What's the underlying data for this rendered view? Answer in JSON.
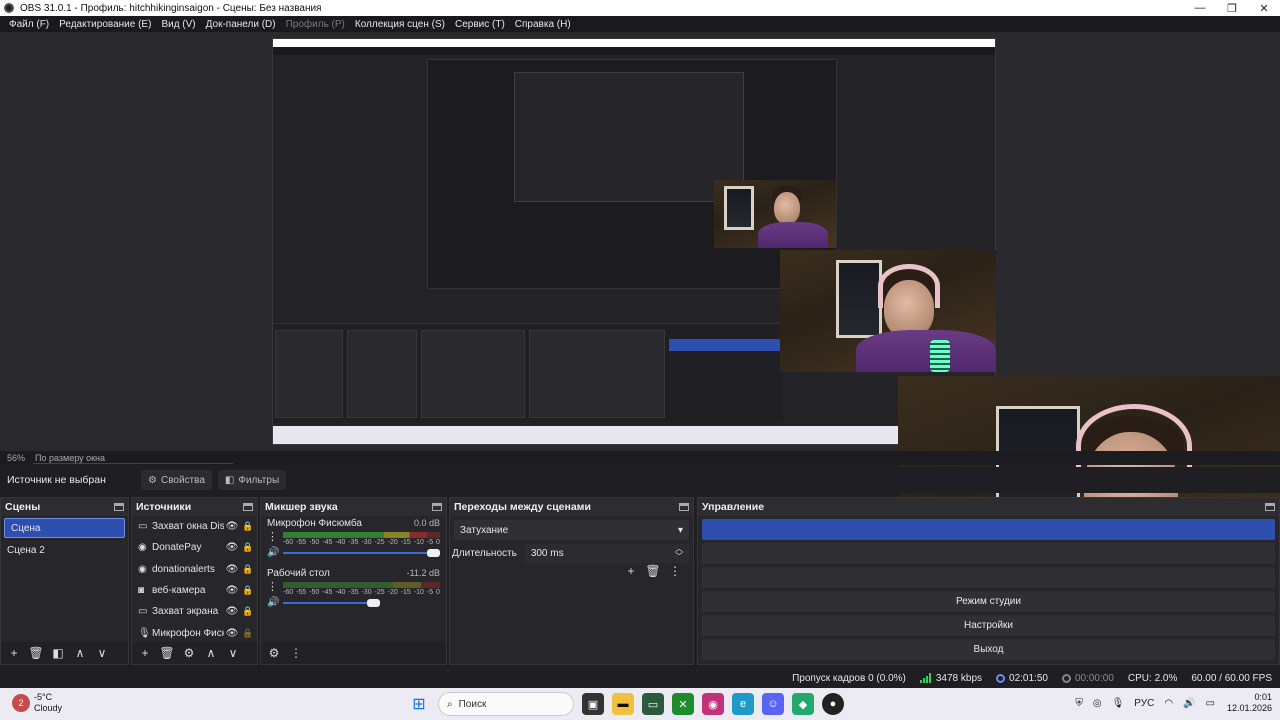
{
  "window": {
    "title": "OBS 31.0.1 - Профиль: hitchhikinginsaigon - Сцены: Без названия",
    "minimize": "—",
    "maximize": "❐",
    "close": "✕"
  },
  "menu": [
    {
      "label": "Файл (F)",
      "enabled": true
    },
    {
      "label": "Редактирование (E)",
      "enabled": true
    },
    {
      "label": "Вид (V)",
      "enabled": true
    },
    {
      "label": "Док-панели (D)",
      "enabled": true
    },
    {
      "label": "Профиль (P)",
      "enabled": false
    },
    {
      "label": "Коллекция сцен (S)",
      "enabled": true
    },
    {
      "label": "Сервис (T)",
      "enabled": true
    },
    {
      "label": "Справка (H)",
      "enabled": true
    }
  ],
  "preview": {
    "zoom_percent": "56%",
    "zoom_mode": "По размеру окна"
  },
  "source_toolbar": {
    "no_source": "Источник не выбран",
    "properties": "Свойства",
    "filters": "Фильтры"
  },
  "scenes": {
    "title": "Сцены",
    "items": [
      "Сцена",
      "Сцена 2"
    ],
    "active_index": 0
  },
  "sources": {
    "title": "Источники",
    "items": [
      {
        "name": "Захват окна Disc",
        "icon": "window-capture-icon",
        "visible": true,
        "locked": true
      },
      {
        "name": "DonatePay",
        "icon": "browser-icon",
        "visible": true,
        "locked": true
      },
      {
        "name": "donationalerts",
        "icon": "browser-icon",
        "visible": true,
        "locked": true
      },
      {
        "name": "веб-камера",
        "icon": "camera-icon",
        "visible": true,
        "locked": true
      },
      {
        "name": "Захват экрана",
        "icon": "display-capture-icon",
        "visible": true,
        "locked": true
      },
      {
        "name": "Микрофон Фиск",
        "icon": "microphone-icon",
        "visible": true,
        "locked": false
      }
    ]
  },
  "mixer": {
    "title": "Микшер звука",
    "channels": [
      {
        "name": "Микрофон Фисюмба",
        "db": "0.0 dB",
        "level": 0.92,
        "volume": 1.0
      },
      {
        "name": "Рабочий стол",
        "db": "-11.2 dB",
        "level": 0.0,
        "volume": 0.62
      }
    ],
    "ticks": [
      "-60",
      "-55",
      "-50",
      "-45",
      "-40",
      "-35",
      "-30",
      "-25",
      "-20",
      "-15",
      "-10",
      "-5",
      "0"
    ]
  },
  "transitions": {
    "title": "Переходы между сценами",
    "selected": "Затухание",
    "duration_label": "Длительность",
    "duration_value": "300 ms"
  },
  "controls": {
    "title": "Управление",
    "buttons": [
      "Режим студии",
      "Настройки",
      "Выход"
    ]
  },
  "status": {
    "dropped": "Пропуск кадров 0 (0.0%)",
    "bitrate": "3478 kbps",
    "stream_time": "02:01:50",
    "rec_time": "00:00:00",
    "cpu": "CPU: 2.0%",
    "fps": "60.00 / 60.00 FPS"
  },
  "taskbar": {
    "weather_badge": "2",
    "temp": "-5°C",
    "condition": "Cloudy",
    "search": "Поиск",
    "lang": "РУС",
    "time": "0:01",
    "date": "12.01.2026"
  },
  "colors": {
    "accent": "#2f4fb0",
    "meter_green": "#3aca36",
    "meter_yellow": "#d8d02a",
    "meter_red": "#d83434",
    "bitrate_green": "#2fd35a"
  }
}
